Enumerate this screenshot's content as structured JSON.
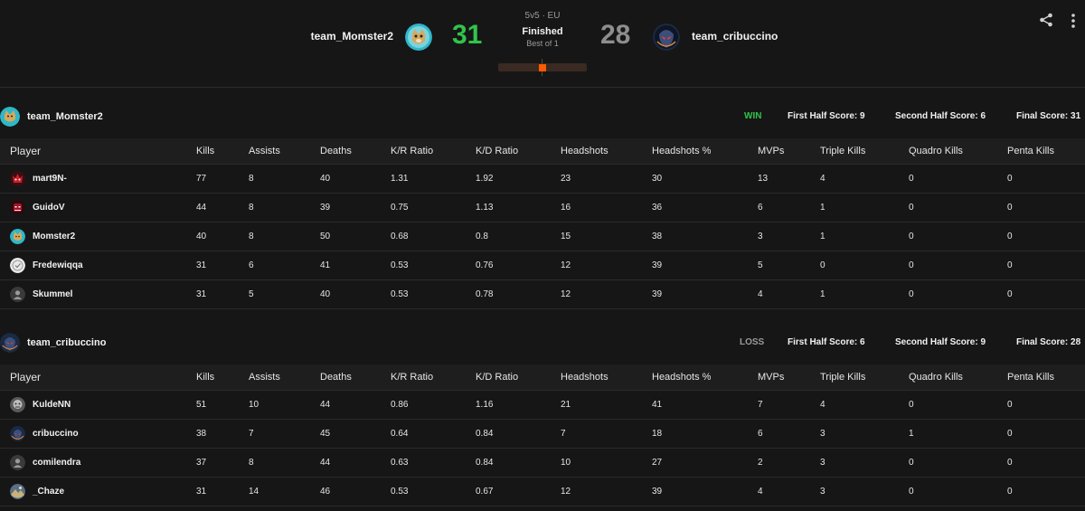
{
  "match": {
    "mode": "5v5 · EU",
    "status": "Finished",
    "best_of": "Best of 1",
    "progress_fraction": 0.5
  },
  "teams": [
    {
      "name": "team_Momster2",
      "score": "31",
      "result": "WIN",
      "first_half": "First Half Score: 9",
      "second_half": "Second Half Score: 6",
      "final": "Final Score: 31",
      "accent": "#32c34b",
      "players": [
        {
          "name": "mart9N-",
          "avatar": "red-demon",
          "stats": [
            "77",
            "8",
            "40",
            "1.31",
            "1.92",
            "23",
            "30",
            "13",
            "4",
            "0",
            "0"
          ]
        },
        {
          "name": "GuidoV",
          "avatar": "red-mask",
          "stats": [
            "44",
            "8",
            "39",
            "0.75",
            "1.13",
            "16",
            "36",
            "6",
            "1",
            "0",
            "0"
          ]
        },
        {
          "name": "Momster2",
          "avatar": "dog",
          "stats": [
            "40",
            "8",
            "50",
            "0.68",
            "0.8",
            "15",
            "38",
            "3",
            "1",
            "0",
            "0"
          ]
        },
        {
          "name": "Fredewiqqa",
          "avatar": "white-badge",
          "stats": [
            "31",
            "6",
            "41",
            "0.53",
            "0.76",
            "12",
            "39",
            "5",
            "0",
            "0",
            "0"
          ]
        },
        {
          "name": "Skummel",
          "avatar": "default-user",
          "stats": [
            "31",
            "5",
            "40",
            "0.53",
            "0.78",
            "12",
            "39",
            "4",
            "1",
            "0",
            "0"
          ]
        }
      ]
    },
    {
      "name": "team_cribuccino",
      "score": "28",
      "result": "LOSS",
      "first_half": "First Half Score: 6",
      "second_half": "Second Half Score: 9",
      "final": "Final Score: 28",
      "accent": "#8e8e8e",
      "players": [
        {
          "name": "KuldeNN",
          "avatar": "gray-face",
          "stats": [
            "51",
            "10",
            "44",
            "0.86",
            "1.16",
            "21",
            "41",
            "7",
            "4",
            "0",
            "0"
          ]
        },
        {
          "name": "cribuccino",
          "avatar": "alien",
          "stats": [
            "38",
            "7",
            "45",
            "0.64",
            "0.84",
            "7",
            "18",
            "6",
            "3",
            "1",
            "0"
          ]
        },
        {
          "name": "comilendra",
          "avatar": "default-user",
          "stats": [
            "37",
            "8",
            "44",
            "0.63",
            "0.84",
            "10",
            "27",
            "2",
            "3",
            "0",
            "0"
          ]
        },
        {
          "name": "_Chaze",
          "avatar": "landscape",
          "stats": [
            "31",
            "14",
            "46",
            "0.53",
            "0.67",
            "12",
            "39",
            "4",
            "3",
            "0",
            "0"
          ]
        }
      ]
    }
  ],
  "columns": [
    "Player",
    "Kills",
    "Assists",
    "Deaths",
    "K/R Ratio",
    "K/D Ratio",
    "Headshots",
    "Headshots %",
    "MVPs",
    "Triple Kills",
    "Quadro Kills",
    "Penta Kills"
  ],
  "icons": {
    "share": "share-icon",
    "more": "more-vertical-icon"
  },
  "colors": {
    "win": "#32c34b",
    "loss": "#9b9b9b",
    "progress": "#ff5a00",
    "background": "#161616"
  }
}
